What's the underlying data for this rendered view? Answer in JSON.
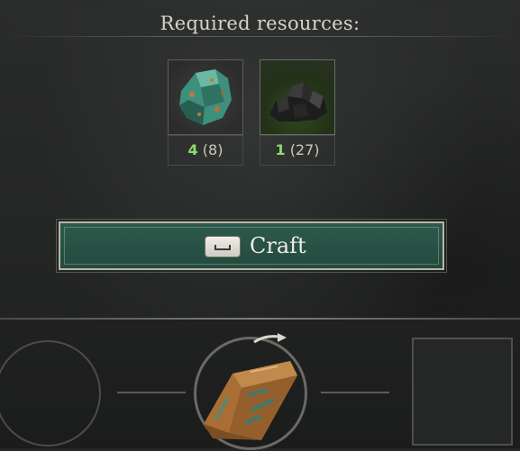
{
  "header": {
    "title": "Required resources:"
  },
  "resources": [
    {
      "name": "ore-icon",
      "have": "4",
      "total": "(8)"
    },
    {
      "name": "coal-icon",
      "have": "1",
      "total": "(27)"
    }
  ],
  "craft": {
    "label": "Craft",
    "key_icon": "spacebar-key-icon"
  },
  "result": {
    "icon": "ingot-icon"
  },
  "colors": {
    "accent": "#2d5a4d",
    "have_text": "#8fd96e"
  }
}
